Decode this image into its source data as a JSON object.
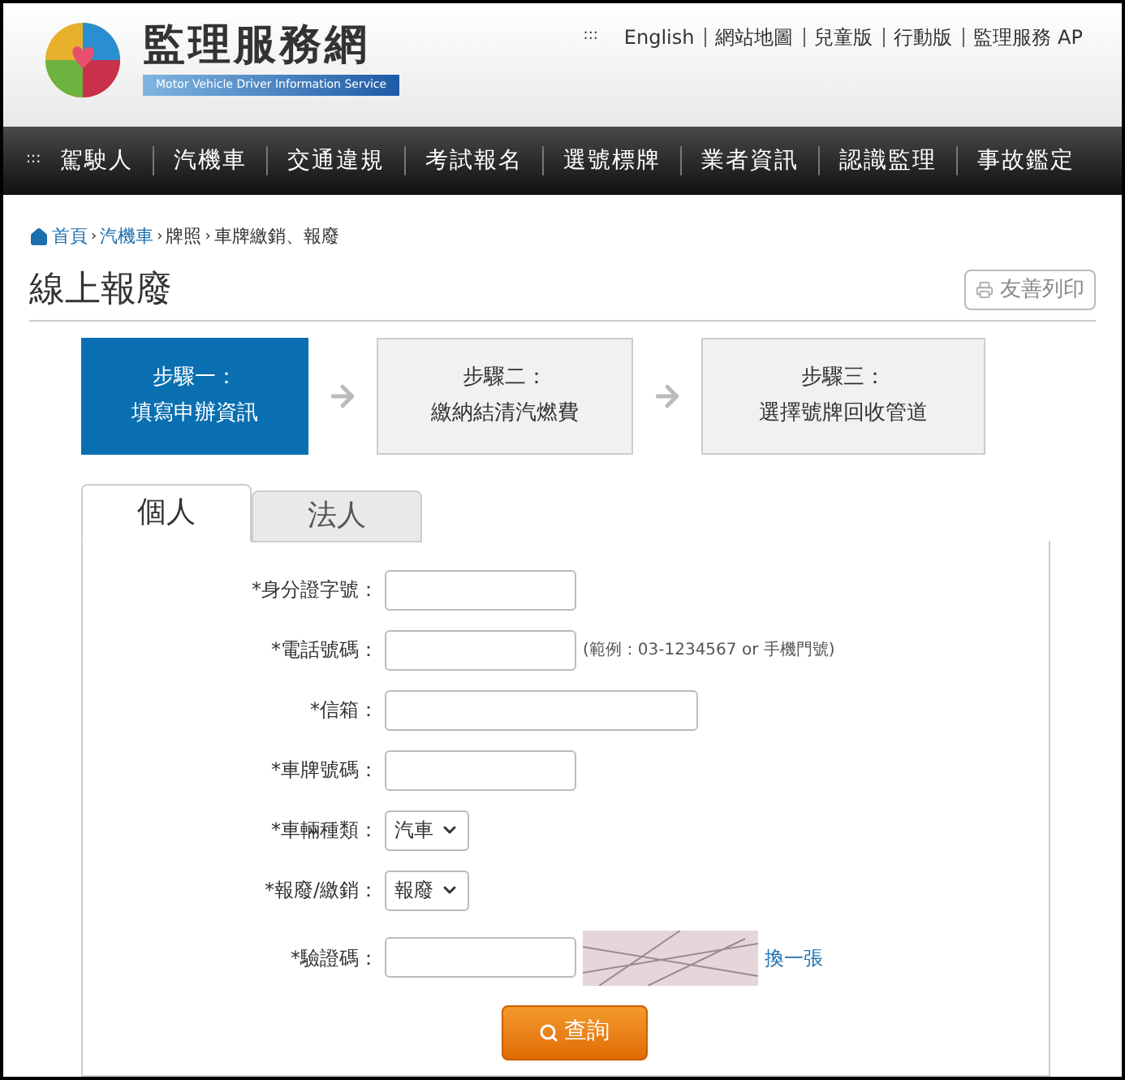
{
  "header": {
    "logo_title": "監理服務網",
    "logo_subtitle": "Motor Vehicle Driver Information Service",
    "top_links_marker": ":::",
    "top_links": [
      "English",
      "網站地圖",
      "兒童版",
      "行動版",
      "監理服務 AP"
    ]
  },
  "nav": {
    "marker": ":::",
    "items": [
      "駕駛人",
      "汽機車",
      "交通違規",
      "考試報名",
      "選號標牌",
      "業者資訊",
      "認識監理",
      "事故鑑定"
    ]
  },
  "breadcrumb": [
    {
      "label": "首頁",
      "link": true
    },
    {
      "separator": "›",
      "label": "汽機車",
      "link": true
    },
    {
      "separator": "›",
      "label": "牌照",
      "link": false
    },
    {
      "separator": "›",
      "label": "車牌繳銷、報廢",
      "link": false
    }
  ],
  "page_title": "線上報廢",
  "print_button": "友善列印",
  "steps": [
    {
      "title": "步驟一：",
      "subtitle": "填寫申辦資訊",
      "selected": true
    },
    {
      "title": "步驟二：",
      "subtitle": "繳納結清汽燃費",
      "selected": false
    },
    {
      "title": "步驟三：",
      "subtitle": "選擇號牌回收管道",
      "selected": false
    }
  ],
  "tabs": [
    {
      "label": "個人",
      "selected": true
    },
    {
      "label": "法人",
      "selected": false
    }
  ],
  "form": [
    {
      "kind": "text",
      "label": "*身分證字號："
    },
    {
      "kind": "text",
      "label": "*電話號碼：",
      "hint": "(範例：03-1234567 or 手機門號)"
    },
    {
      "kind": "email",
      "label": "*信箱："
    },
    {
      "kind": "text",
      "label": "*車牌號碼："
    },
    {
      "kind": "select",
      "label": "*車輛種類：",
      "value": "汽車"
    },
    {
      "kind": "select",
      "label": "*報廢/繳銷：",
      "value": "報廢"
    },
    {
      "kind": "captcha",
      "label": "*驗證碼：",
      "refresh": "換一張"
    }
  ],
  "submit": "查詢"
}
